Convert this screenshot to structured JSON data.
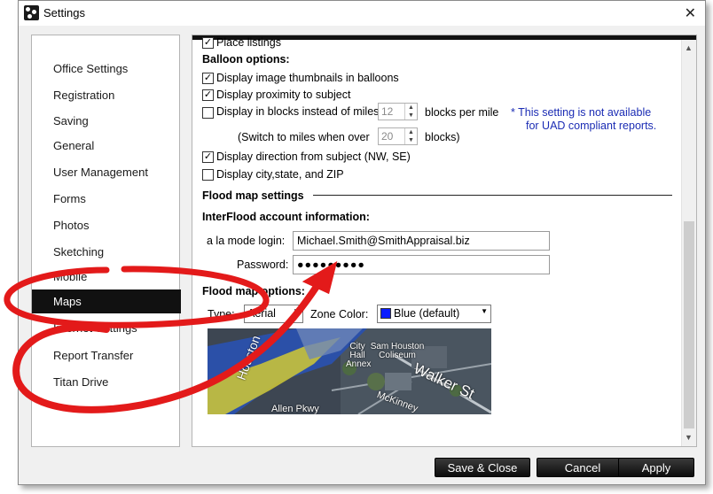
{
  "window": {
    "title": "Settings"
  },
  "sidebar": {
    "items": [
      {
        "label": "Office Settings"
      },
      {
        "label": "Registration"
      },
      {
        "label": "Saving"
      },
      {
        "label": "General"
      },
      {
        "label": "User Management"
      },
      {
        "label": "Forms"
      },
      {
        "label": "Photos"
      },
      {
        "label": "Sketching"
      },
      {
        "label": "Mobile"
      },
      {
        "label": "Maps"
      },
      {
        "label": "Internet Settings"
      },
      {
        "label": "Report Transfer"
      },
      {
        "label": "Titan Drive"
      }
    ],
    "selected": "Maps"
  },
  "panel": {
    "place_listings_label": "Place listings",
    "balloon_heading": "Balloon options:",
    "options": [
      {
        "label": "Display image thumbnails in balloons",
        "checked": true
      },
      {
        "label": "Display proximity to subject",
        "checked": true
      },
      {
        "label": "Display in blocks instead of miles",
        "checked": false
      },
      {
        "label": "Display direction from subject (NW, SE)",
        "checked": true
      },
      {
        "label": "Display city,state, and ZIP",
        "checked": false
      }
    ],
    "blocks_per_mile_value": "12",
    "blocks_per_mile_label": "blocks per mile",
    "switch_label": "(Switch to miles when over",
    "switch_value": "20",
    "switch_unit": "blocks)",
    "note_line1": "*  This setting is not available",
    "note_line2": "for UAD compliant reports.",
    "flood_heading": "Flood map settings",
    "interflood_heading": "InterFlood account information:",
    "login_label": "a la mode login:",
    "login_value": "Michael.Smith@SmithAppraisal.biz",
    "password_label": "Password:",
    "password_value": "●●●●●●●●●",
    "flood_options_heading": "Flood map options:",
    "type_label": "Type:",
    "type_value": "Aerial",
    "zone_color_label": "Zone Color:",
    "zone_color_value": "Blue (default)",
    "zone_color_hex": "#0a1cff",
    "map_labels": {
      "houston": "Houston",
      "city_hall": "City Hall Annex",
      "coliseum": "Sam Houston Coliseum",
      "walker": "Walker St",
      "allen": "Allen Pkwy",
      "mckinney": "McKinney"
    }
  },
  "buttons": {
    "save_close": "Save & Close",
    "cancel": "Cancel",
    "apply": "Apply"
  }
}
